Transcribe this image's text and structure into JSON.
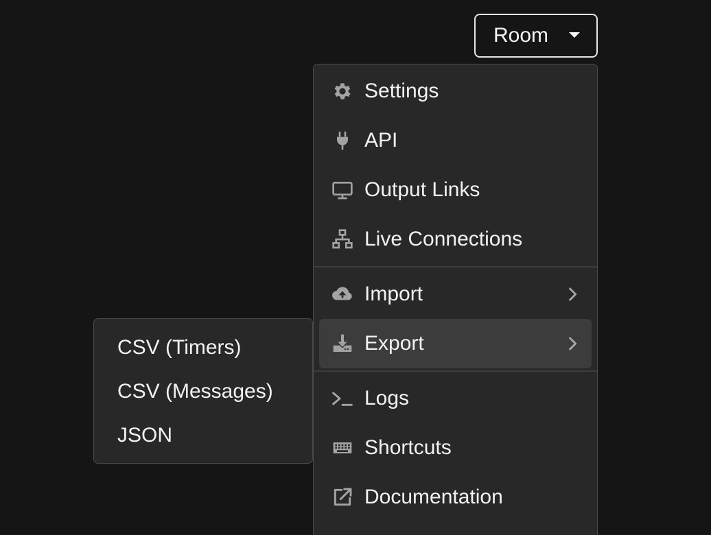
{
  "room_button": {
    "label": "Room"
  },
  "menu": {
    "groups": [
      [
        {
          "label": "Settings",
          "icon": "gear-icon"
        },
        {
          "label": "API",
          "icon": "plug-icon"
        },
        {
          "label": "Output Links",
          "icon": "monitor-icon"
        },
        {
          "label": "Live Connections",
          "icon": "network-icon"
        }
      ],
      [
        {
          "label": "Import",
          "icon": "cloud-upload-icon",
          "has_submenu": true
        },
        {
          "label": "Export",
          "icon": "download-icon",
          "has_submenu": true,
          "active": true
        }
      ],
      [
        {
          "label": "Logs",
          "icon": "terminal-icon"
        },
        {
          "label": "Shortcuts",
          "icon": "keyboard-icon"
        },
        {
          "label": "Documentation",
          "icon": "external-link-icon"
        }
      ]
    ]
  },
  "export_submenu": {
    "items": [
      {
        "label": "CSV (Timers)"
      },
      {
        "label": "CSV (Messages)"
      },
      {
        "label": "JSON"
      }
    ]
  },
  "colors": {
    "background": "#151515",
    "menu_bg": "#282828",
    "active_item_bg": "#3c3c3c",
    "icon": "#a3a3a3",
    "text": "#f2f2f2"
  }
}
